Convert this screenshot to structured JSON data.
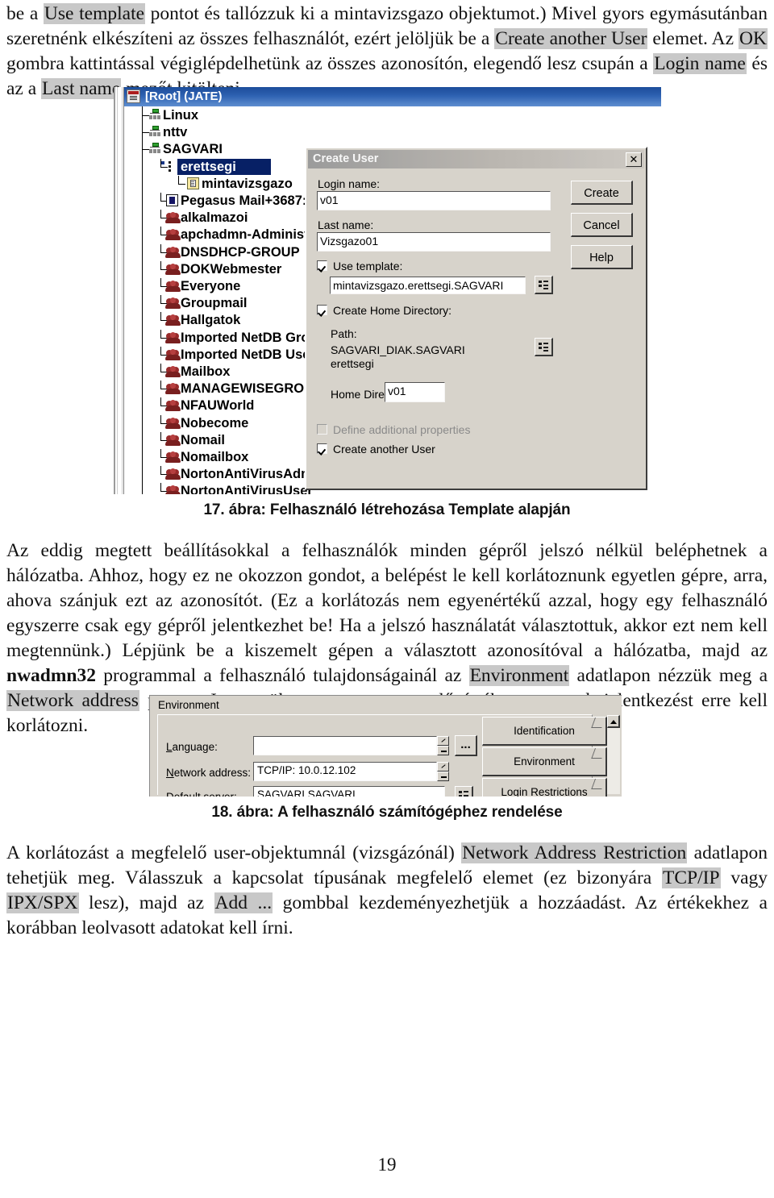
{
  "page": {
    "number": "19"
  },
  "paragraphs": {
    "p1": {
      "runs": [
        {
          "t": "be a ",
          "hl": false
        },
        {
          "t": "Use template",
          "hl": true
        },
        {
          "t": " pontot és tallózzuk ki a mintavizsgazo objektumot.) Mivel gyors egymásutánban szeretnénk elkészíteni az összes felhasználót, ezért jelöljük be a ",
          "hl": false
        },
        {
          "t": "Create another User",
          "hl": true
        },
        {
          "t": " elemet. Az ",
          "hl": false
        },
        {
          "t": "OK",
          "hl": true
        },
        {
          "t": " gombra kattintással végiglépdelhetünk az összes azonosítón, elegendő lesz csupán a ",
          "hl": false
        },
        {
          "t": "Login name",
          "hl": true
        },
        {
          "t": " és az a ",
          "hl": false
        },
        {
          "t": "Last name",
          "hl": true
        },
        {
          "t": " mezőt kitölteni.",
          "hl": false
        }
      ]
    },
    "p2": {
      "runs": [
        {
          "t": "Az eddig megtett beállításokkal a felhasználók minden gépről jelszó nélkül beléphetnek a hálózatba. Ahhoz, hogy ez ne okozzon gondot, a belépést le kell korlátoznunk egyetlen gépre, arra, ahova szánjuk ezt az azonosítót. (Ez a korlátozás nem egyenértékű azzal, hogy egy felhasználó egyszerre csak egy gépről jelentkezhet be! Ha a jelszó használatát választottuk, akkor ezt nem kell megtennünk.) Lépjünk be a kiszemelt gépen a választott azonosítóval a hálózatba, majd az ",
          "hl": false
        },
        {
          "t": "nwadmn32",
          "hl": false,
          "bold": true
        },
        {
          "t": " programmal a felhasználó tulajdonságainál az ",
          "hl": false
        },
        {
          "t": "Environment",
          "hl": true
        },
        {
          "t": " adatlapon nézzük meg a ",
          "hl": false
        },
        {
          "t": "Network address",
          "hl": true
        },
        {
          "t": " pontot. Jegyezzük meg az ott szereplő értéket, mert a bejelentkezést erre kell korlátozni.",
          "hl": false
        }
      ]
    },
    "p3": {
      "runs": [
        {
          "t": "A korlátozást a megfelelő user-objektumnál (vizsgázónál) ",
          "hl": false
        },
        {
          "t": "Network Address Restriction",
          "hl": true
        },
        {
          "t": " adatlapon tehetjük meg. Válasszuk a kapcsolat típusának megfelelő elemet (ez bizonyára ",
          "hl": false
        },
        {
          "t": "TCP/IP",
          "hl": true
        },
        {
          "t": " vagy ",
          "hl": false
        },
        {
          "t": "IPX/SPX",
          "hl": true
        },
        {
          "t": " lesz), majd az ",
          "hl": false
        },
        {
          "t": "Add ...",
          "hl": true
        },
        {
          "t": " gombbal kezdeményezhetjük a hozzáadást. Az értékekhez a korábban leolvasott adatokat kell írni.",
          "hl": false
        }
      ]
    }
  },
  "figures": {
    "fig17": {
      "caption": "17. ábra: Felhasználó létrehozása Template alapján",
      "tree": {
        "root_label": "[Root] (JATE)",
        "items": [
          {
            "label": "Linux",
            "level": 1,
            "icon": "tree-icon"
          },
          {
            "label": "nttv",
            "level": 1,
            "icon": "tree-icon"
          },
          {
            "label": "SAGVARI",
            "level": 1,
            "icon": "tree-icon"
          },
          {
            "label": "erettsegi",
            "level": 2,
            "icon": "ou-icon",
            "selected": true
          },
          {
            "label": "mintavizsgazo",
            "level": 3,
            "icon": "user-icon"
          },
          {
            "label": "Pegasus Mail+3687:",
            "level": 2,
            "icon": "app-icon"
          },
          {
            "label": "alkalmazoi",
            "level": 2,
            "icon": "group-icon"
          },
          {
            "label": "apchadmn-Administ",
            "level": 2,
            "icon": "group-icon"
          },
          {
            "label": "DNSDHCP-GROUP",
            "level": 2,
            "icon": "group-icon"
          },
          {
            "label": "DOKWebmester",
            "level": 2,
            "icon": "group-icon"
          },
          {
            "label": "Everyone",
            "level": 2,
            "icon": "group-icon"
          },
          {
            "label": "Groupmail",
            "level": 2,
            "icon": "group-icon"
          },
          {
            "label": "Hallgatok",
            "level": 2,
            "icon": "group-icon"
          },
          {
            "label": "Imported NetDB Gro",
            "level": 2,
            "icon": "group-icon"
          },
          {
            "label": "Imported NetDB Use",
            "level": 2,
            "icon": "group-icon"
          },
          {
            "label": "Mailbox",
            "level": 2,
            "icon": "group-icon"
          },
          {
            "label": "MANAGEWISEGROU",
            "level": 2,
            "icon": "group-icon"
          },
          {
            "label": "NFAUWorld",
            "level": 2,
            "icon": "group-icon"
          },
          {
            "label": "Nobecome",
            "level": 2,
            "icon": "group-icon"
          },
          {
            "label": "Nomail",
            "level": 2,
            "icon": "group-icon"
          },
          {
            "label": "Nomailbox",
            "level": 2,
            "icon": "group-icon"
          },
          {
            "label": "NortonAntiVirusAdm",
            "level": 2,
            "icon": "group-icon"
          },
          {
            "label": "NortonAntiVirusUser",
            "level": 2,
            "icon": "group-icon"
          }
        ]
      },
      "dialog": {
        "title": "Create User",
        "close_label": "✕",
        "login_name_label": "Login name:",
        "login_name_value": "v01",
        "last_name_label": "Last name:",
        "last_name_value": "Vizsgazo01",
        "use_template_label": "Use template:",
        "use_template_value": "mintavizsgazo.erettsegi.SAGVARI",
        "create_home_label": "Create Home Directory:",
        "path_label": "Path:",
        "path_value_line1": "SAGVARI_DIAK.SAGVARI",
        "path_value_line2": "erettsegi",
        "home_dir_label": "Home Directory:",
        "home_dir_value": "v01",
        "define_props_label": "Define additional properties",
        "create_another_label": "Create another User",
        "buttons": {
          "create": "Create",
          "cancel": "Cancel",
          "help": "Help"
        }
      }
    },
    "fig18": {
      "caption": "18. ábra: A felhasználó számítógéphez rendelése",
      "panel": {
        "title": "Environment",
        "language_label": "Language:",
        "language_value": "",
        "network_address_label": "Network address:",
        "network_address_value": "TCP/IP: 10.0.12.102",
        "default_server_label": "Default server:",
        "default_server_value": "SAGVARI.SAGVARI",
        "ellipsis_button": "...",
        "tabs": [
          {
            "label": "Identification"
          },
          {
            "label": "Environment"
          },
          {
            "label": "Login Restrictions"
          }
        ]
      }
    }
  },
  "colors": {
    "highlight": "#c8c8c8",
    "title_bar": "#1d4f9e",
    "dialog_face": "#d4d0c8",
    "selection": "#0a246a"
  }
}
